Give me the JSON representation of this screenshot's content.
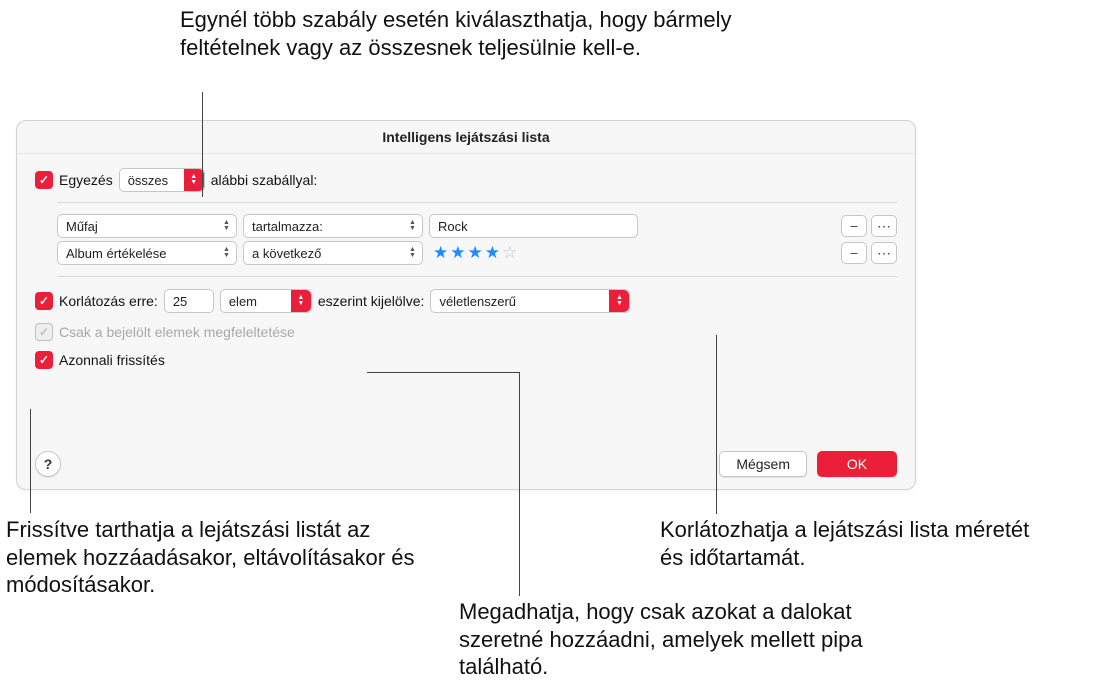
{
  "callouts": {
    "top": "Egynél több szabály esetén kiválaszthatja, hogy bármely feltételnek vagy az összesnek teljesülnie kell-e.",
    "limit": "Korlátozhatja a lejátszási lista méretét és időtartamát.",
    "checked_only": "Megadhatja, hogy csak azokat a dalokat szeretné hozzáadni, amelyek mellett pipa található.",
    "live_update": "Frissítve tarthatja a lejátszási listát az elemek hozzáadásakor, eltávolításakor és módosításakor."
  },
  "dialog": {
    "title": "Intelligens lejátszási lista",
    "match": {
      "label_prefix": "Egyezés",
      "mode": "összes",
      "label_suffix": "alábbi szabállyal:"
    },
    "rules": [
      {
        "field": "Műfaj",
        "operator": "tartalmazza:",
        "value": "Rock",
        "value_type": "text"
      },
      {
        "field": "Album értékelése",
        "operator": "a következő",
        "value": 4,
        "value_type": "stars"
      }
    ],
    "limit": {
      "label": "Korlátozás erre:",
      "count": "25",
      "unit": "elem",
      "selected_by_label": "eszerint kijelölve:",
      "selected_by": "véletlenszerű"
    },
    "checked_only_label": "Csak a bejelölt elemek megfeleltetése",
    "live_update_label": "Azonnali frissítés",
    "buttons": {
      "cancel": "Mégsem",
      "ok": "OK"
    },
    "help_icon": "?"
  }
}
